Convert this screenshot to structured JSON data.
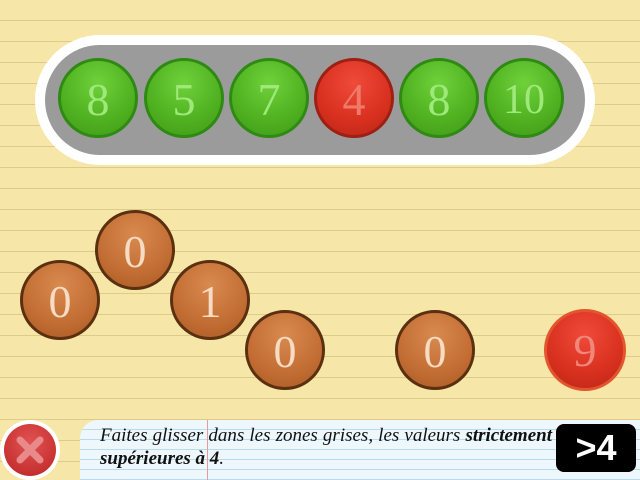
{
  "tray": {
    "slots": [
      {
        "value": "8",
        "color": "green"
      },
      {
        "value": "5",
        "color": "green"
      },
      {
        "value": "7",
        "color": "green"
      },
      {
        "value": "4",
        "color": "red"
      },
      {
        "value": "8",
        "color": "green"
      },
      {
        "value": "10",
        "color": "green"
      }
    ]
  },
  "tokens": [
    {
      "value": "0",
      "color": "copper"
    },
    {
      "value": "0",
      "color": "copper"
    },
    {
      "value": "1",
      "color": "copper"
    },
    {
      "value": "0",
      "color": "copper"
    },
    {
      "value": "0",
      "color": "copper"
    },
    {
      "value": "9",
      "color": "red"
    }
  ],
  "instruction": {
    "text": "Faites glisser dans les zones grises, les valeurs",
    "bold": "strictement supérieures à 4",
    "end": "."
  },
  "badge": ">4",
  "close_button": {
    "icon": "close-icon"
  },
  "colors": {
    "green": "#4fb020",
    "red": "#d8301f",
    "copper": "#c26d33",
    "background": "#f6e6a7"
  }
}
